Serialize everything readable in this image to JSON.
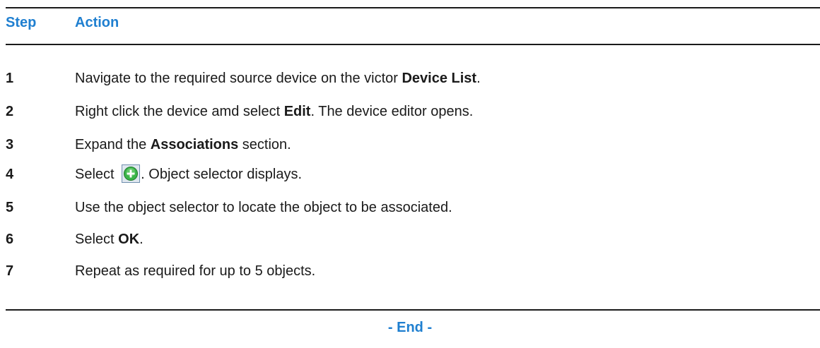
{
  "header": {
    "step_label": "Step",
    "action_label": "Action"
  },
  "steps": [
    {
      "num": "1",
      "pre": "Navigate to the required source device on the victor ",
      "bold": "Device List",
      "post": "."
    },
    {
      "num": "2",
      "pre": "Right click the device amd select ",
      "bold": "Edit",
      "post": ". The device editor opens."
    },
    {
      "num": "3",
      "pre": "Expand the ",
      "bold": "Associations",
      "post": " section."
    },
    {
      "num": "4",
      "pre": "Select ",
      "icon": "add-circle-icon",
      "post": ". Object selector displays."
    },
    {
      "num": "5",
      "pre": "Use the object selector to locate the object to be associated.",
      "bold": "",
      "post": ""
    },
    {
      "num": "6",
      "pre": "Select ",
      "bold": "OK",
      "post": "."
    },
    {
      "num": "7",
      "pre": "Repeat as required for up to 5 objects.",
      "bold": "",
      "post": ""
    }
  ],
  "footer": {
    "end_label": "- End -"
  },
  "colors": {
    "heading_blue": "#1f7fd0",
    "text": "#1a1a1a",
    "icon_green": "#3bb54a"
  }
}
